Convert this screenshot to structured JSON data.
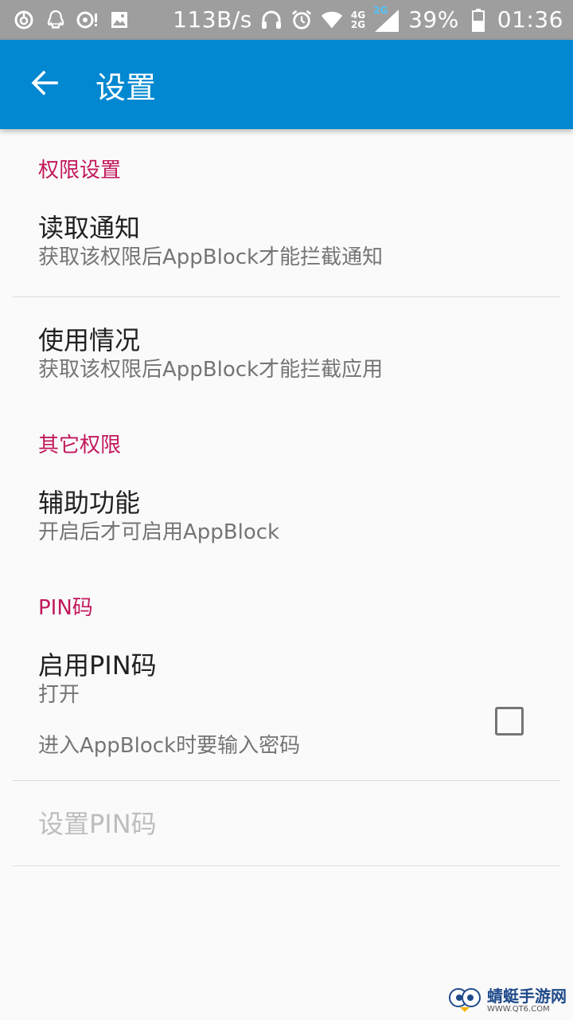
{
  "status_bar": {
    "net_speed": "113B/s",
    "net_4g": "4G",
    "net_2g_top": "2G",
    "net_2g": "2G",
    "battery": "39%",
    "time": "01:36",
    "icons": [
      "netease-music-icon",
      "qq-icon",
      "alert-icon",
      "image-icon",
      "headphones-icon",
      "alarm-icon",
      "wifi-icon",
      "signal-icon",
      "battery-icon"
    ]
  },
  "app_bar": {
    "title": "设置",
    "back_icon": "arrow-back-icon",
    "color": "#0288d1"
  },
  "sections": {
    "permission": {
      "header": "权限设置",
      "read_notifications": {
        "title": "读取通知",
        "summary": "获取该权限后AppBlock才能拦截通知"
      },
      "usage": {
        "title": "使用情况",
        "summary": "获取该权限后AppBlock才能拦截应用"
      }
    },
    "other": {
      "header": "其它权限",
      "accessibility": {
        "title": "辅助功能",
        "summary": "开启后才可启用AppBlock"
      }
    },
    "pin": {
      "header": "PIN码",
      "enable_pin": {
        "title": "启用PIN码",
        "summary": "打开",
        "description": "进入AppBlock时要输入密码",
        "checked": false
      },
      "set_pin": {
        "title": "设置PIN码",
        "enabled": false
      }
    }
  },
  "accent_color": "#c2185b",
  "watermark": {
    "main": "蜻蜓手游网",
    "sub": "WWW.QT6.COM"
  }
}
